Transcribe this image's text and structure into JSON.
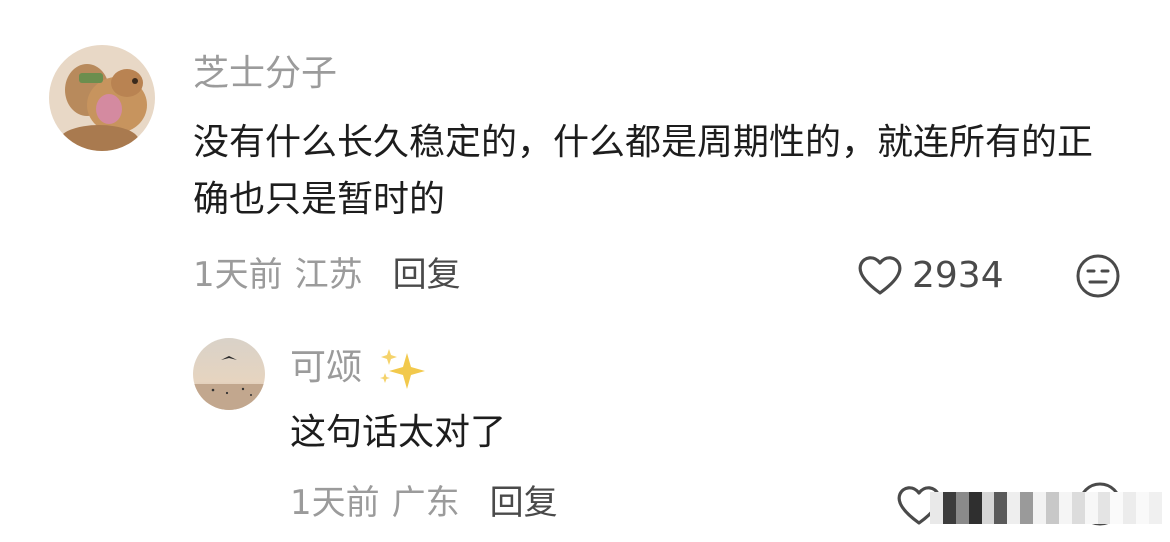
{
  "comments": [
    {
      "username": "芝士分子",
      "text": "没有什么长久稳定的，什么都是周期性的，就连所有的正确也只是暂时的",
      "time": "1天前",
      "location": "江苏",
      "reply_label": "回复",
      "likes": "2934",
      "icons": {
        "like": "heart-outline-icon",
        "react": "neutral-face-icon"
      }
    },
    {
      "username": "可颂",
      "username_suffix_icon": "sparkles-icon",
      "text": "这句话太对了",
      "time": "1天前",
      "location": "广东",
      "reply_label": "回复",
      "icons": {
        "like": "heart-outline-icon",
        "react": "face-icon"
      }
    }
  ],
  "colors": {
    "text": "#1d1d1d",
    "muted": "#9b9b9b",
    "action": "#4a4a4a",
    "sparkle": "#f2c94c"
  }
}
